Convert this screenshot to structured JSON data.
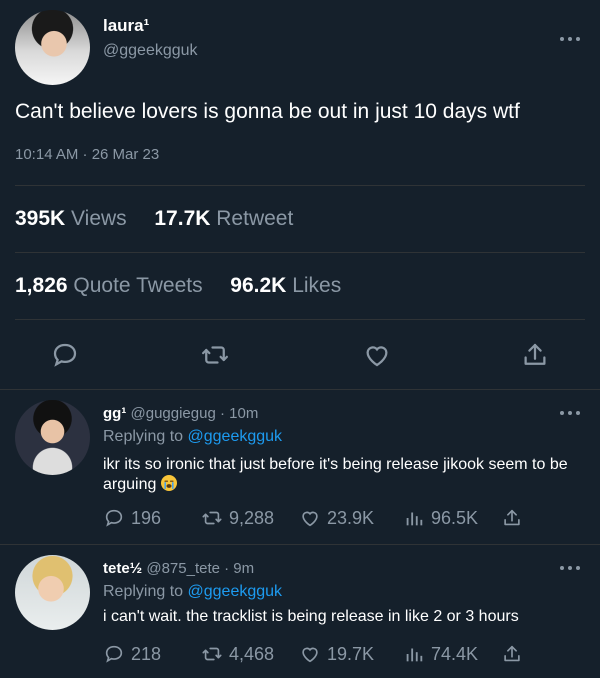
{
  "main_tweet": {
    "display_name": "laura¹",
    "handle": "@ggeekgguk",
    "text": "Can't believe lovers is gonna be out in just 10 days wtf",
    "time": "10:14 AM · 26 Mar 23",
    "views_count": "395K",
    "views_label": "Views",
    "retweet_count": "17.7K",
    "retweet_label": "Retweet",
    "quote_count": "1,826",
    "quote_label": "Quote Tweets",
    "likes_count": "96.2K",
    "likes_label": "Likes"
  },
  "replies": [
    {
      "display_name": "gg¹",
      "handle_time": "@guggiegug · 10m",
      "replying_prefix": "Replying to",
      "replying_to": "@ggeekgguk",
      "text": "ikr its so ironic that just before it's being release jikook seem to be arguing",
      "emoji": "loudly-crying-face",
      "replies": "196",
      "retweets": "9,288",
      "likes": "23.9K",
      "views": "96.5K"
    },
    {
      "display_name": "tete½",
      "handle_time": "@875_tete · 9m",
      "replying_prefix": "Replying to",
      "replying_to": "@ggeekgguk",
      "text": "i can't wait. the tracklist is being release in like 2 or 3 hours",
      "replies": "218",
      "retweets": "4,468",
      "likes": "19.7K",
      "views": "74.4K"
    }
  ],
  "colors": {
    "background": "#15202b",
    "muted": "#8b98a5",
    "link": "#1d9bf0",
    "divider": "#2f3336"
  }
}
